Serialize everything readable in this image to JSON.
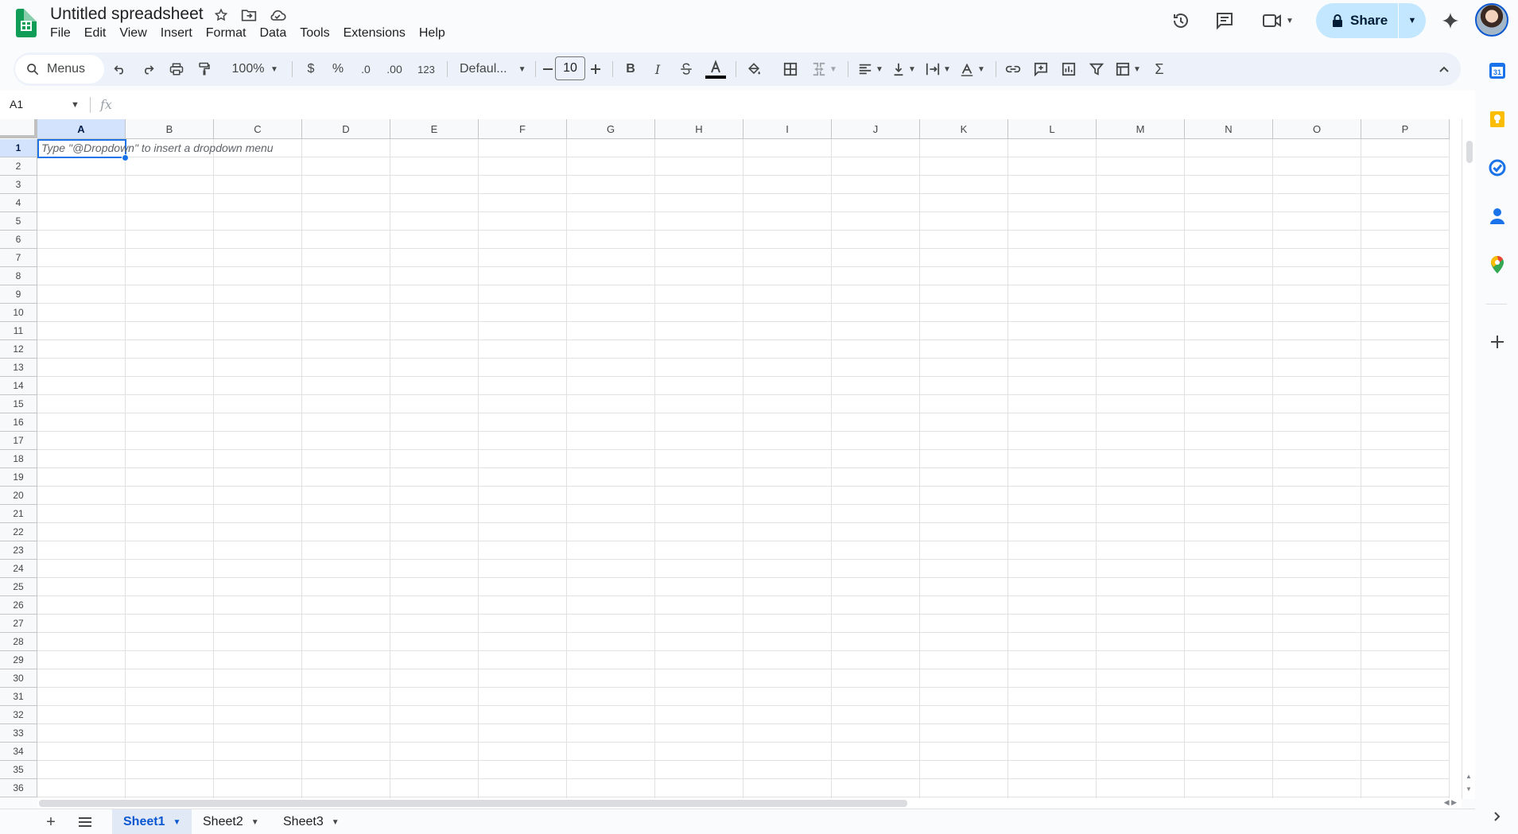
{
  "app": {
    "title": "Untitled spreadsheet",
    "menu": [
      "File",
      "Edit",
      "View",
      "Insert",
      "Format",
      "Data",
      "Tools",
      "Extensions",
      "Help"
    ],
    "share_label": "Share",
    "colors": {
      "accent": "#1a73e8",
      "share_bg": "#c2e7ff",
      "toolbar_bg": "#edf2fa",
      "brand": "#0f9d58"
    }
  },
  "toolbar": {
    "menus_label": "Menus",
    "zoom": "100%",
    "currency": "$",
    "percent": "%",
    "dec_decrease": ".0",
    "dec_increase": ".00",
    "number_format": "123",
    "font": "Defaul...",
    "font_size": "10",
    "bold": "B",
    "italic": "I",
    "sigma": "Σ"
  },
  "formula_bar": {
    "name_box": "A1",
    "fx": "fx"
  },
  "grid": {
    "columns": [
      "A",
      "B",
      "C",
      "D",
      "E",
      "F",
      "G",
      "H",
      "I",
      "J",
      "K",
      "L",
      "M",
      "N",
      "O",
      "P"
    ],
    "rows": [
      "1",
      "2",
      "3",
      "4",
      "5",
      "6",
      "7",
      "8",
      "9",
      "10",
      "11",
      "12",
      "13",
      "14",
      "15",
      "16",
      "17",
      "18",
      "19",
      "20",
      "21",
      "22",
      "23",
      "24",
      "25",
      "26",
      "27",
      "28",
      "29",
      "30",
      "31",
      "32",
      "33",
      "34",
      "35",
      "36"
    ],
    "selected_cell": "A1",
    "hint": "Type \"@Dropdown\"  to insert a dropdown menu"
  },
  "sheets": [
    {
      "label": "Sheet1",
      "active": true
    },
    {
      "label": "Sheet2",
      "active": false
    },
    {
      "label": "Sheet3",
      "active": false
    }
  ],
  "side_panel": [
    "calendar-icon",
    "keep-icon",
    "tasks-icon",
    "contacts-icon",
    "maps-icon",
    "add-icon"
  ]
}
